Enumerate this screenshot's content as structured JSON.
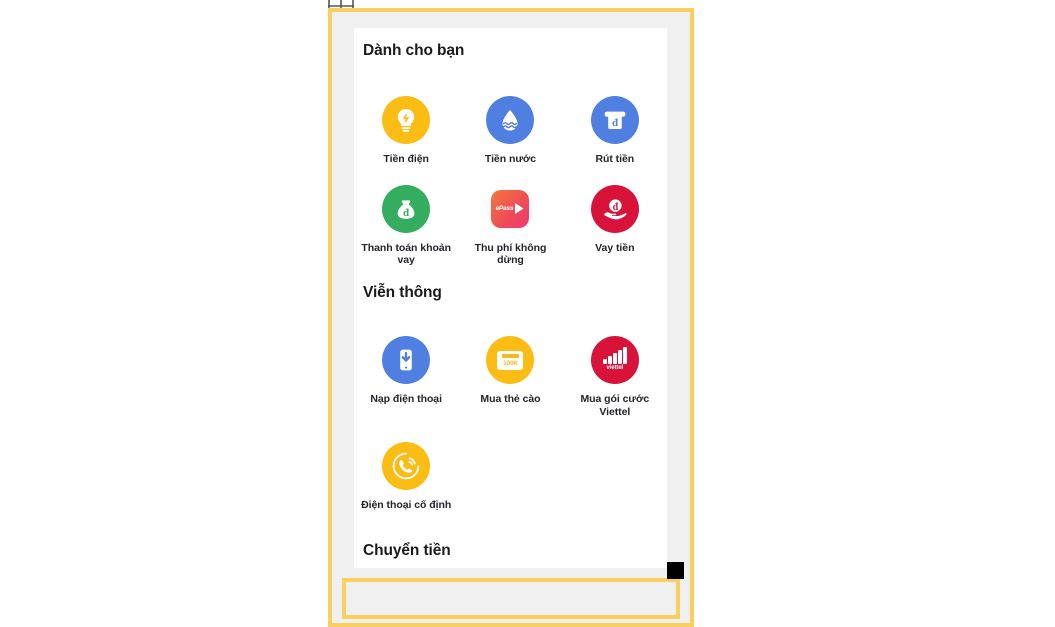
{
  "app": {
    "card_bg": "#ffffff",
    "page_bg": "#f0f0f0",
    "highlight_color": "#f9cf5f"
  },
  "sections": [
    {
      "id": "for-you",
      "title": "Dành cho bạn",
      "items": [
        {
          "label": "Tiền điện",
          "icon": "lightbulb-icon",
          "color": "#fbbc14"
        },
        {
          "label": "Tiền nước",
          "icon": "water-drop-icon",
          "color": "#4f7fe0"
        },
        {
          "label": "Rút tiền",
          "icon": "atm-withdraw-icon",
          "color": "#4f7fe0"
        },
        {
          "label": "Thanh toán khoản vay",
          "icon": "money-bag-icon",
          "color": "#34ad5e"
        },
        {
          "label": "Thu phí không dừng",
          "icon": "epass-icon",
          "color": "#ef4a56",
          "badge_text": "ePass"
        },
        {
          "label": "Vay tiền",
          "icon": "hand-coin-icon",
          "color": "#d9123a"
        }
      ]
    },
    {
      "id": "telecom",
      "title": "Viễn thông",
      "items": [
        {
          "label": "Nạp điện thoại",
          "icon": "phone-topup-icon",
          "color": "#4f7fe0"
        },
        {
          "label": "Mua thẻ cào",
          "icon": "scratch-card-icon",
          "color": "#fbbc14",
          "amount_text": "100K"
        },
        {
          "label": "Mua gói cước Viettel",
          "icon": "viettel-signal-icon",
          "color": "#d9123a",
          "brand_text": "viettel"
        },
        {
          "label": "Điện thoại cố định",
          "icon": "landline-phone-icon",
          "color": "#fbbc14"
        }
      ]
    },
    {
      "id": "transfer",
      "title": "Chuyển tiền",
      "items": []
    }
  ],
  "overlays": {
    "viewport_label": "highlighted-viewport",
    "bottom_region_label": "highlighted-empty-region",
    "cursor_label": "cursor-marker",
    "corner_widget_label": "resize-handle-widget"
  }
}
